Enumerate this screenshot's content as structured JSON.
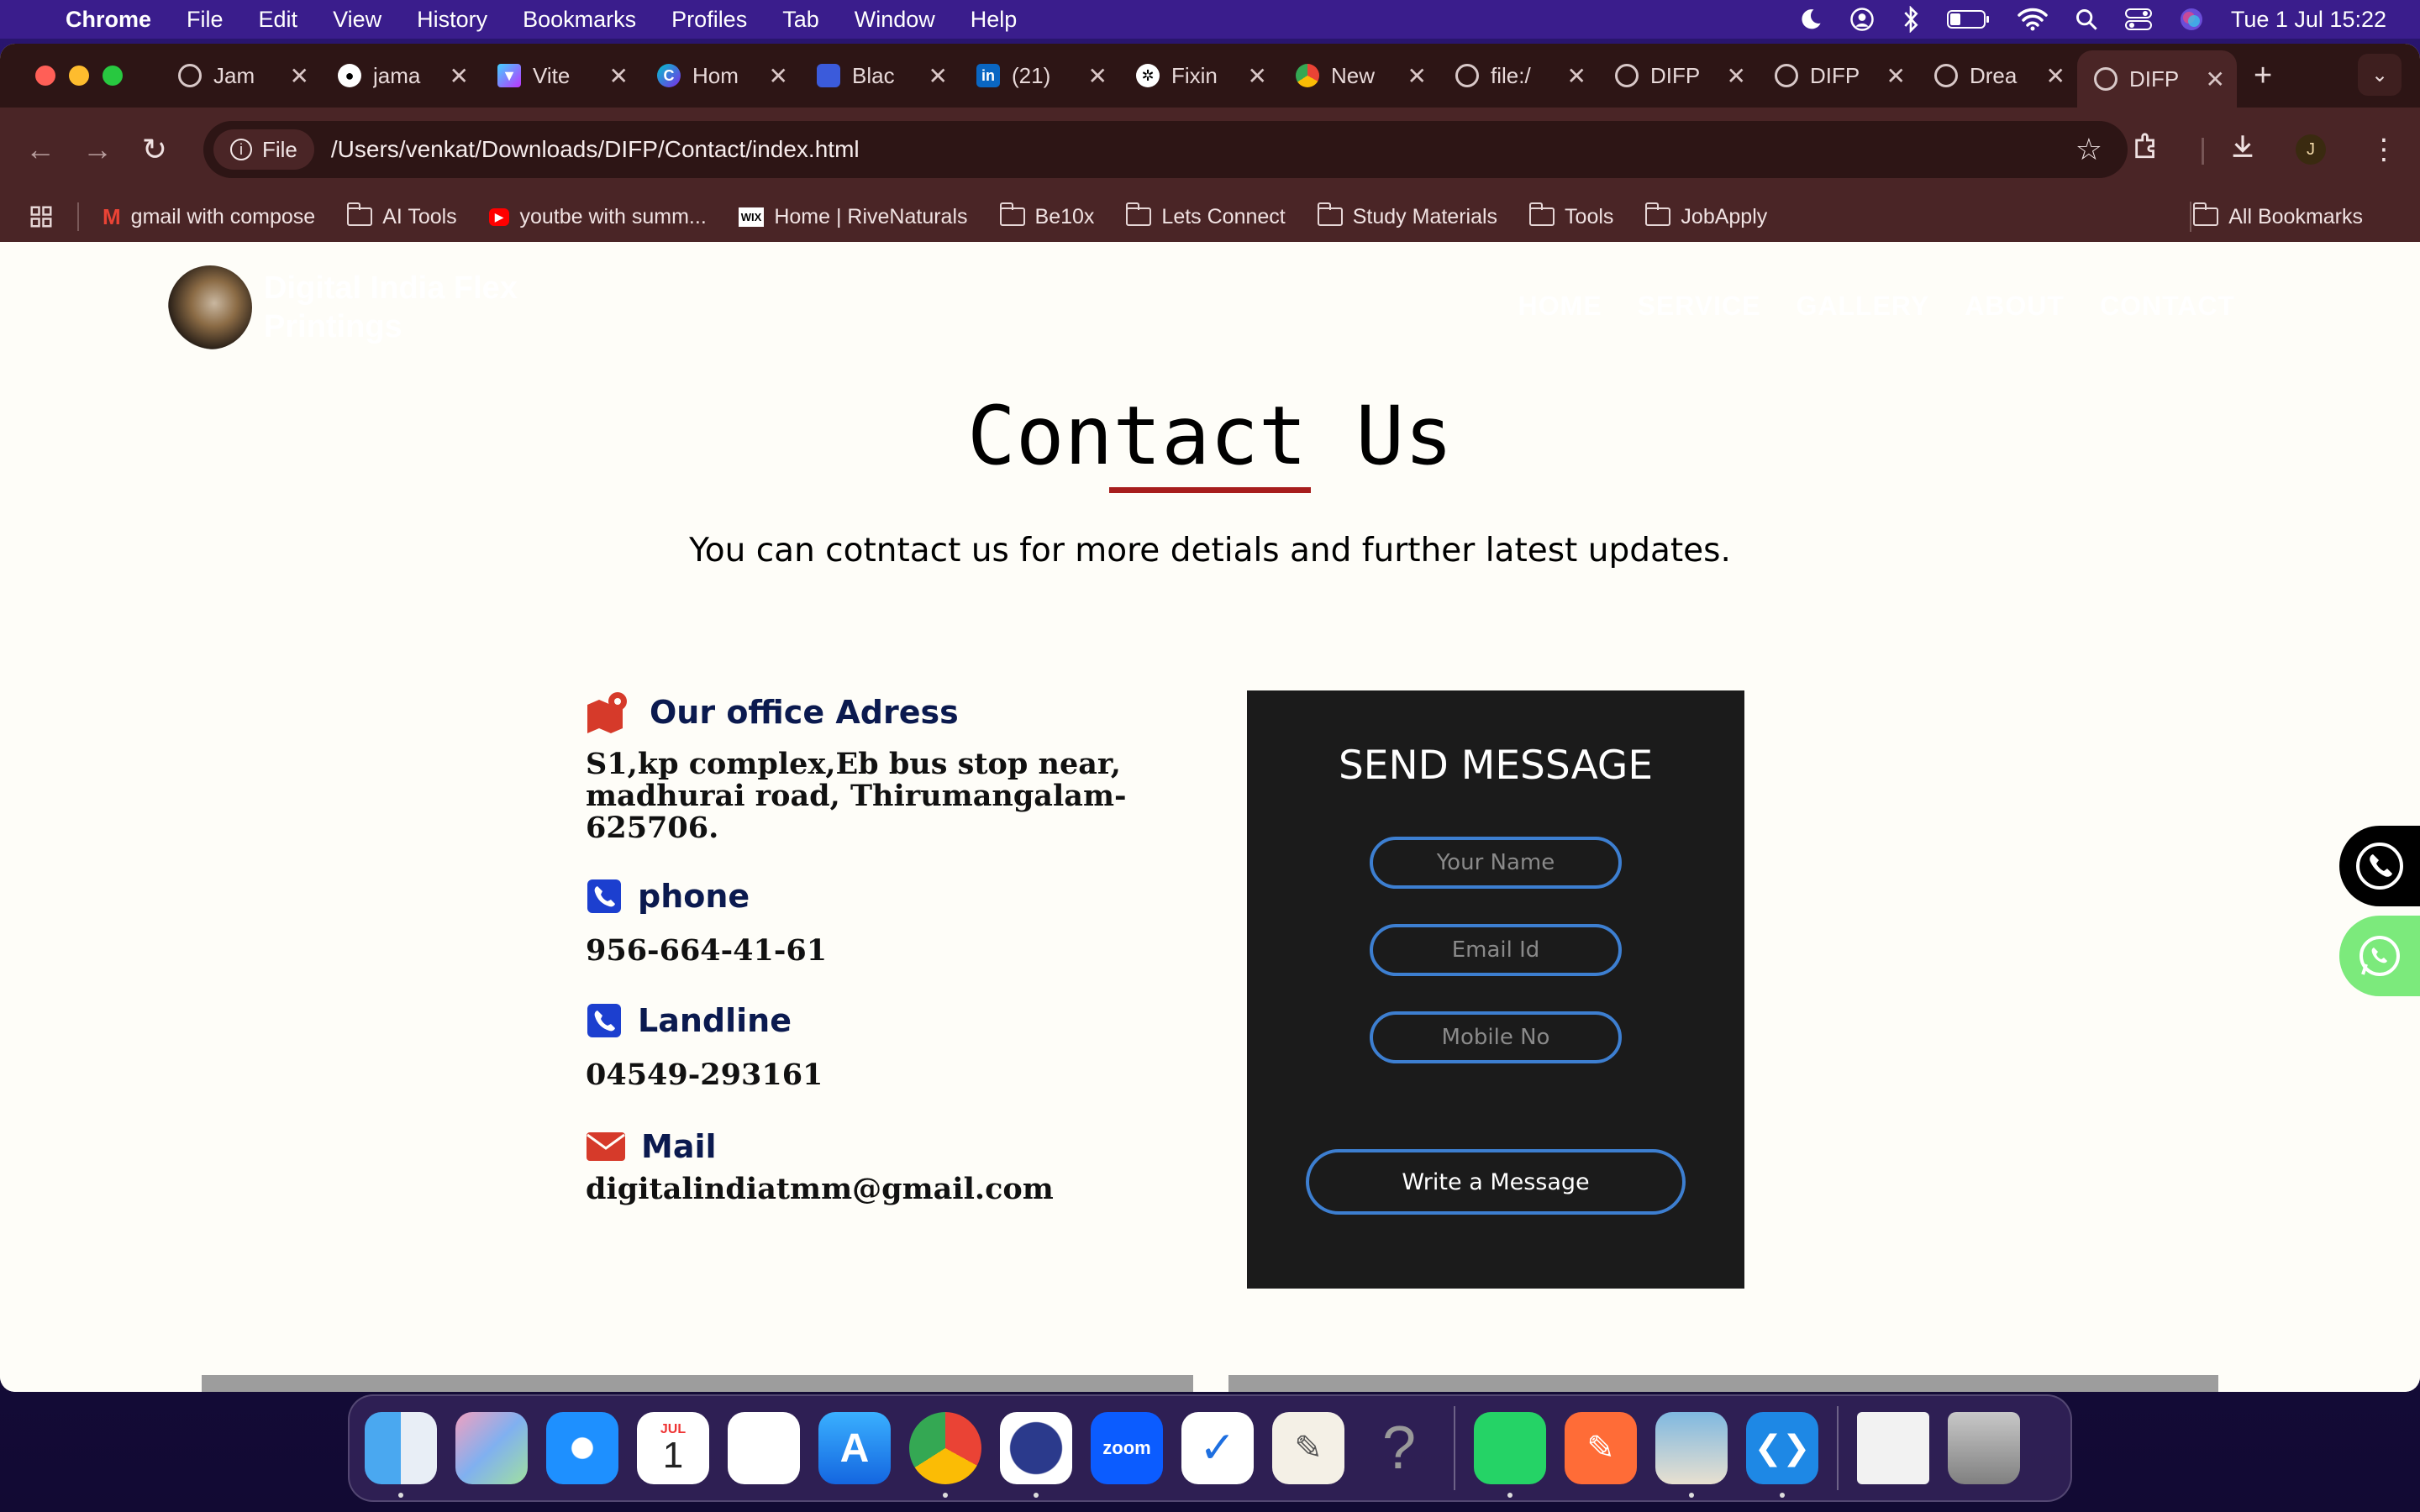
{
  "menubar": {
    "app": "Chrome",
    "items": [
      "File",
      "Edit",
      "View",
      "History",
      "Bookmarks",
      "Profiles",
      "Tab",
      "Window",
      "Help"
    ],
    "clock": "Tue 1 Jul  15:22"
  },
  "tabs": [
    {
      "title": "Jam",
      "icon": "globe-icon"
    },
    {
      "title": "jama",
      "icon": "github-icon"
    },
    {
      "title": "Vite",
      "icon": "vite-icon"
    },
    {
      "title": "Hom",
      "icon": "canva-icon"
    },
    {
      "title": "Blac",
      "icon": "app-icon"
    },
    {
      "title": "(21)",
      "icon": "linkedin-icon"
    },
    {
      "title": "Fixin",
      "icon": "openai-icon"
    },
    {
      "title": "New",
      "icon": "chrome-icon"
    },
    {
      "title": "file:/",
      "icon": "globe-icon"
    },
    {
      "title": "DIFP",
      "icon": "globe-icon"
    },
    {
      "title": "DIFP",
      "icon": "globe-icon"
    },
    {
      "title": "Drea",
      "icon": "globe-icon"
    },
    {
      "title": "DIFP",
      "icon": "globe-icon",
      "active": true
    }
  ],
  "toolbar": {
    "chip": "File",
    "url": "/Users/venkat/Downloads/DIFP/Contact/index.html",
    "avatar": "J"
  },
  "bookmarks": [
    {
      "label": "gmail with compose",
      "icon": "gmail-icon"
    },
    {
      "label": "AI Tools",
      "icon": "folder-icon"
    },
    {
      "label": "youtbe with summ...",
      "icon": "youtube-icon"
    },
    {
      "label": "Home | RiveNaturals",
      "icon": "wix-icon"
    },
    {
      "label": "Be10x",
      "icon": "folder-icon"
    },
    {
      "label": "Lets Connect",
      "icon": "folder-icon"
    },
    {
      "label": "Study Materials",
      "icon": "folder-icon"
    },
    {
      "label": "Tools",
      "icon": "folder-icon"
    },
    {
      "label": "JobApply",
      "icon": "folder-icon"
    }
  ],
  "all_bookmarks": "All Bookmarks",
  "site": {
    "brand": "Digital India Flex Printings",
    "nav": [
      "HOME",
      "SERVICE",
      "GALLERY",
      "ABOUT",
      "CONTACT"
    ]
  },
  "contact": {
    "title": "Contact Us",
    "subtitle": "You can cotntact us for more detials and further latest updates.",
    "office_heading": "Our office Adress",
    "office_value": "S1,kp complex,Eb bus stop near, madhurai road, Thirumangalam-625706.",
    "phone_heading": "phone",
    "phone_value": "956-664-41-61",
    "landline_heading": "Landline",
    "landline_value": "04549-293161",
    "mail_heading": "Mail",
    "mail_value": "digitalindiatmm@gmail.com"
  },
  "form": {
    "title": "SEND MESSAGE",
    "name_placeholder": "Your Name",
    "email_placeholder": "Email Id",
    "mobile_placeholder": "Mobile No",
    "submit": "Write a Message"
  },
  "dock": {
    "calendar_month": "JUL",
    "calendar_day": "1",
    "zoom_label": "zoom"
  },
  "colors": {
    "accent_underline": "#a71d1d",
    "form_border": "#3d7fd1",
    "heading_navy": "#0b1a4f",
    "icon_red": "#d63a2a",
    "icon_blue": "#1c3fcf"
  }
}
